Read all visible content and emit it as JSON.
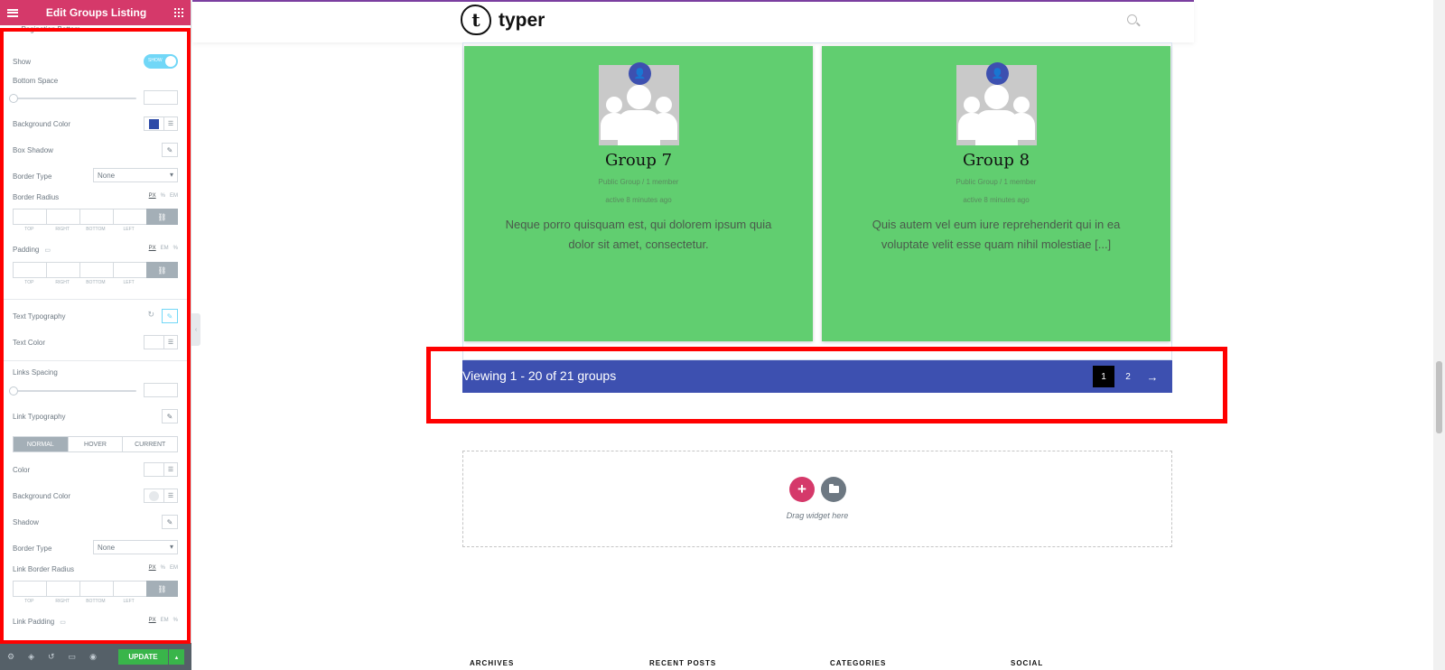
{
  "panel": {
    "title": "Edit Groups Listing",
    "section": "Pagination Bottom",
    "show_label": "Show",
    "show_toggle_text": "SHOW",
    "bottom_space_label": "Bottom Space",
    "bg_color_label": "Background Color",
    "bg_color_value": "#2d4aa8",
    "box_shadow_label": "Box Shadow",
    "border_type_label": "Border Type",
    "border_type_value": "None",
    "border_radius_label": "Border Radius",
    "units_px_pct_em": [
      "PX",
      "%",
      "EM"
    ],
    "units_px_em_pct": [
      "PX",
      "EM",
      "%"
    ],
    "dims_labels": [
      "TOP",
      "RIGHT",
      "BOTTOM",
      "LEFT"
    ],
    "padding_label": "Padding",
    "text_typography_label": "Text Typography",
    "text_color_label": "Text Color",
    "links_spacing_label": "Links Spacing",
    "link_typography_label": "Link Typography",
    "state_tabs": [
      "NORMAL",
      "HOVER",
      "CURRENT"
    ],
    "color_label": "Color",
    "link_bg_color_label": "Background Color",
    "shadow_label": "Shadow",
    "link_border_type_label": "Border Type",
    "link_border_type_value": "None",
    "link_border_radius_label": "Link Border Radius",
    "link_padding_label": "Link Padding",
    "update_label": "UPDATE"
  },
  "site": {
    "logo_letter": "t",
    "logo_text": "typer"
  },
  "groups": [
    {
      "name": "Group 7",
      "meta": "Public Group / 1 member",
      "active": "active 8 minutes ago",
      "description": "Neque porro quisquam est, qui dolorem ipsum quia dolor sit amet, consectetur."
    },
    {
      "name": "Group 8",
      "meta": "Public Group / 1 member",
      "active": "active 8 minutes ago",
      "description": "Quis autem vel eum iure reprehenderit qui in ea voluptate velit esse quam nihil molestiae [...]"
    }
  ],
  "pagination": {
    "viewing": "Viewing 1 - 20 of 21 groups",
    "pages": [
      "1",
      "2"
    ],
    "current_page": "1",
    "next": "→"
  },
  "dropzone": {
    "text": "Drag widget here"
  },
  "footer_columns": [
    "ARCHIVES",
    "RECENT POSTS",
    "CATEGORIES",
    "SOCIAL"
  ],
  "colors": {
    "brand_pink": "#d5396a",
    "card_green": "#61ce70",
    "pager_blue": "#3d50b0",
    "highlight_red": "#ff0000"
  }
}
